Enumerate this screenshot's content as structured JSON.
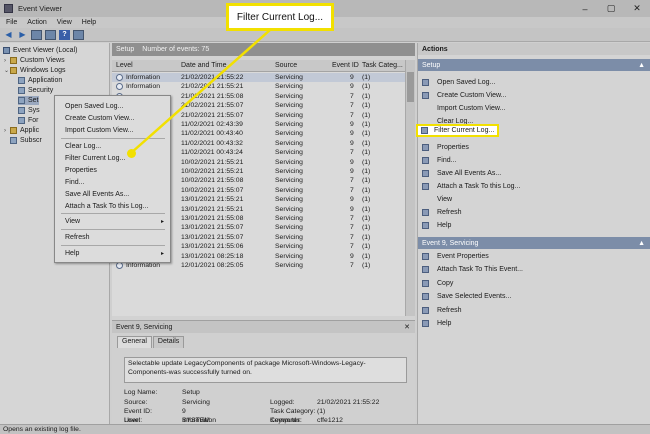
{
  "window": {
    "title": "Event Viewer",
    "controls": [
      "–",
      "▢",
      "✕"
    ]
  },
  "menu": [
    "File",
    "Action",
    "View",
    "Help"
  ],
  "toolbar": {
    "icons": [
      "back-arrow-icon",
      "forward-arrow-icon",
      "folder-icon",
      "properties-icon",
      "help-icon",
      "panel-icon"
    ],
    "help_label": "?"
  },
  "tree": {
    "root": "Event Viewer (Local)",
    "custom_views": "Custom Views",
    "windows_logs": "Windows Logs",
    "application": "Application",
    "security": "Security",
    "setup": "Set",
    "system": "Sys",
    "forwarded": "For",
    "app_services": "Applic",
    "subscriptions": "Subscr"
  },
  "middle": {
    "log_name": "Setup",
    "event_count": "Number of events: 75",
    "columns": [
      "Level",
      "Date and Time",
      "Source",
      "Event ID",
      "Task Categ..."
    ],
    "rows": [
      {
        "level": "Information",
        "date": "21/02/2021 21:55:22",
        "source": "Servicing",
        "id": "9",
        "task": "(1)"
      },
      {
        "level": "Information",
        "date": "21/02/2021 21:55:21",
        "source": "Servicing",
        "id": "9",
        "task": "(1)"
      },
      {
        "level": "",
        "date": "21/02/2021 21:55:08",
        "source": "Servicing",
        "id": "7",
        "task": "(1)"
      },
      {
        "level": "",
        "date": "21/02/2021 21:55:07",
        "source": "Servicing",
        "id": "7",
        "task": "(1)"
      },
      {
        "level": "",
        "date": "21/02/2021 21:55:07",
        "source": "Servicing",
        "id": "7",
        "task": "(1)"
      },
      {
        "level": "",
        "date": "11/02/2021 02:43:39",
        "source": "Servicing",
        "id": "9",
        "task": "(1)"
      },
      {
        "level": "",
        "date": "11/02/2021 00:43:40",
        "source": "Servicing",
        "id": "9",
        "task": "(1)"
      },
      {
        "level": "",
        "date": "11/02/2021 00:43:32",
        "source": "Servicing",
        "id": "9",
        "task": "(1)"
      },
      {
        "level": "",
        "date": "11/02/2021 00:43:24",
        "source": "Servicing",
        "id": "7",
        "task": "(1)"
      },
      {
        "level": "",
        "date": "10/02/2021 21:55:21",
        "source": "Servicing",
        "id": "9",
        "task": "(1)"
      },
      {
        "level": "",
        "date": "10/02/2021 21:55:21",
        "source": "Servicing",
        "id": "9",
        "task": "(1)"
      },
      {
        "level": "",
        "date": "10/02/2021 21:55:08",
        "source": "Servicing",
        "id": "7",
        "task": "(1)"
      },
      {
        "level": "",
        "date": "10/02/2021 21:55:07",
        "source": "Servicing",
        "id": "7",
        "task": "(1)"
      },
      {
        "level": "",
        "date": "13/01/2021 21:55:21",
        "source": "Servicing",
        "id": "9",
        "task": "(1)"
      },
      {
        "level": "",
        "date": "13/01/2021 21:55:21",
        "source": "Servicing",
        "id": "9",
        "task": "(1)"
      },
      {
        "level": "",
        "date": "13/01/2021 21:55:08",
        "source": "Servicing",
        "id": "7",
        "task": "(1)"
      },
      {
        "level": "",
        "date": "13/01/2021 21:55:07",
        "source": "Servicing",
        "id": "7",
        "task": "(1)"
      },
      {
        "level": "",
        "date": "13/01/2021 21:55:07",
        "source": "Servicing",
        "id": "7",
        "task": "(1)"
      },
      {
        "level": "",
        "date": "13/01/2021 21:55:06",
        "source": "Servicing",
        "id": "7",
        "task": "(1)"
      },
      {
        "level": "",
        "date": "13/01/2021 08:25:18",
        "source": "Servicing",
        "id": "9",
        "task": "(1)"
      },
      {
        "level": "Information",
        "date": "12/01/2021 08:25:05",
        "source": "Servicing",
        "id": "7",
        "task": "(1)"
      }
    ]
  },
  "detail": {
    "title": "Event 9, Servicing",
    "close": "✕",
    "tabs": [
      "General",
      "Details"
    ],
    "message": "Selectable update LegacyComponents of package Microsoft-Windows-Legacy-Components-was successfully turned on.",
    "fields": {
      "log_name_label": "Log Name:",
      "log_name": "Setup",
      "source_label": "Source:",
      "source": "Servicing",
      "logged_label": "Logged:",
      "logged": "21/02/2021 21:55:22",
      "event_id_label": "Event ID:",
      "event_id": "9",
      "task_label": "Task Category:",
      "task": "(1)",
      "level_label": "Level:",
      "level": "Information",
      "keywords_label": "Keywords:",
      "user_label": "User:",
      "user": "SYSTEM",
      "computer_label": "Computer:",
      "computer": "cffe1212"
    }
  },
  "actions": {
    "title": "Actions",
    "section1": "Setup",
    "items1": [
      "Open Saved Log...",
      "Create Custom View...",
      "Import Custom View...",
      "Clear Log...",
      "Filter Current Log...",
      "Properties",
      "Find...",
      "Save All Events As...",
      "Attach a Task To this Log...",
      "View",
      "Refresh",
      "Help"
    ],
    "section2": "Event 9, Servicing",
    "items2": [
      "Event Properties",
      "Attach Task To This Event...",
      "Copy",
      "Save Selected Events...",
      "Refresh",
      "Help"
    ],
    "collapse": "▲"
  },
  "context_menu": {
    "items": [
      "Open Saved Log...",
      "Create Custom View...",
      "Import Custom View...",
      "Clear Log...",
      "Filter Current Log...",
      "Properties",
      "Find...",
      "Save All Events As...",
      "Attach a Task To this Log...",
      "View",
      "Refresh",
      "Help"
    ],
    "submenu_arrow": "▸"
  },
  "callout": {
    "label": "Filter Current Log...",
    "color": "#f2e000"
  },
  "status": "Opens an existing log file."
}
